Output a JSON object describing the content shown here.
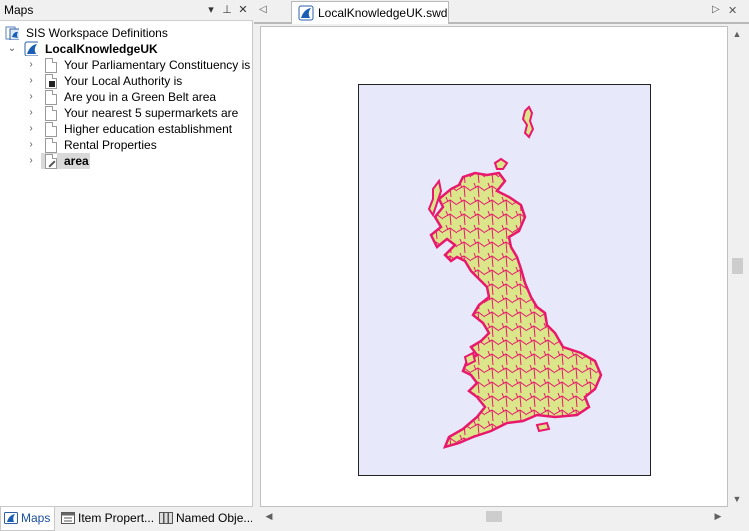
{
  "left_panel": {
    "title": "Maps",
    "buttons": {
      "dropdown": "▾",
      "pin": "⊥",
      "close": "✕"
    },
    "tree": {
      "root_label": "SIS Workspace Definitions",
      "workspace_label": "LocalKnowledgeUK",
      "items": [
        {
          "label": "Your Parliamentary Constituency is"
        },
        {
          "label": "Your Local Authority is"
        },
        {
          "label": "Are you in a Green Belt area"
        },
        {
          "label": "Your nearest 5 supermarkets are"
        },
        {
          "label": "Higher education establishment"
        },
        {
          "label": "Rental Properties"
        },
        {
          "label": "area"
        }
      ],
      "selected_item": "area"
    },
    "bottom_tabs": [
      {
        "label": "Maps",
        "active": true
      },
      {
        "label": "Item Propert..."
      },
      {
        "label": "Named Obje..."
      }
    ]
  },
  "document": {
    "tab_label": "LocalKnowledgeUK.swd",
    "map_fill_color": "#dbe58a",
    "map_border_color": "#e8186d",
    "map_background_color": "#e8e8fb"
  },
  "colors": {
    "accent": "#1a5fb4"
  }
}
